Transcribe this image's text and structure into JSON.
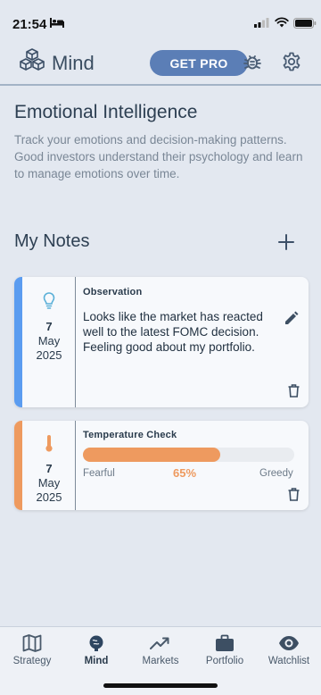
{
  "status_bar": {
    "time": "21:54"
  },
  "header": {
    "title": "Mind",
    "get_pro_label": "GET PRO"
  },
  "intro": {
    "title": "Emotional Intelligence",
    "description": "Track your emotions and decision-making patterns. Good investors understand their psychology and learn to manage emotions over time."
  },
  "notes": {
    "title": "My Notes",
    "items": [
      {
        "type": "Observation",
        "day": "7",
        "month": "May",
        "year": "2025",
        "text": "Looks like the market has reacted well to the latest FOMC decision. Feeling good about my portfolio.",
        "icon": "lightbulb-icon",
        "accent": "#5b9cf0"
      },
      {
        "type": "Temperature Check",
        "day": "7",
        "month": "May",
        "year": "2025",
        "icon": "thermometer-icon",
        "accent": "#ee9a5f",
        "scale_left": "Fearful",
        "scale_right": "Greedy",
        "value_label": "65%",
        "value": 0.65
      }
    ]
  },
  "bottom_nav": {
    "items": [
      {
        "label": "Strategy",
        "icon": "map-icon"
      },
      {
        "label": "Mind",
        "icon": "brain-icon",
        "active": true
      },
      {
        "label": "Markets",
        "icon": "trending-up-icon"
      },
      {
        "label": "Portfolio",
        "icon": "briefcase-icon"
      },
      {
        "label": "Watchlist",
        "icon": "eye-icon"
      }
    ]
  },
  "colors": {
    "accent": "#5b7eb6",
    "background": "#e3e8f0"
  }
}
